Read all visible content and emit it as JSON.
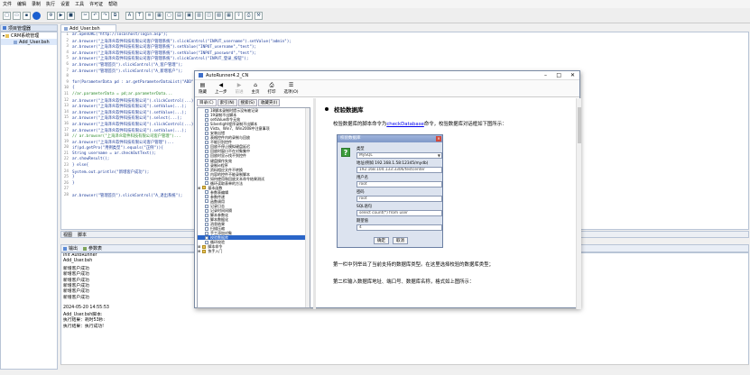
{
  "menu": [
    "文件",
    "编辑",
    "录制",
    "执行",
    "设置",
    "工具",
    "许可证",
    "帮助"
  ],
  "left_panel": {
    "tab": "项目管理器",
    "tree": [
      {
        "label": "CRM系统管理",
        "level": 0
      },
      {
        "label": "Add_User.bsh",
        "level": 1,
        "selected": true
      }
    ]
  },
  "editor": {
    "tab": "Add_User.bsh",
    "lines": [
      {
        "n": "1",
        "t": "ar.openURL(\"http://localhost/login.asp\");"
      },
      {
        "n": "2",
        "t": "ar.browser(\"上海泽众软件科技有限公司客户管理系统\").slickControl(\"INPUT_username\").setValue(\"admin\");"
      },
      {
        "n": "3",
        "t": "ar.browser(\"上海泽众软件科技有限公司客户管理系统\").setValue(\"INPUT_username\",\"test\");"
      },
      {
        "n": "4",
        "t": "ar.browser(\"上海泽众软件科技有限公司客户管理系统\").setValue(\"INPUT_password\",\"test\");"
      },
      {
        "n": "5",
        "t": "ar.browser(\"上海泽众软件科技有限公司客户管理系统\").slickControl(\"INPUT_登录_按钮\");"
      },
      {
        "n": "6",
        "t": "ar.browser(\"管理首页\").slickControl(\"A_客户管理\");"
      },
      {
        "n": "7",
        "t": "ar.browser(\"管理首页\").slickControl(\"A_新增客户\");"
      },
      {
        "n": "8",
        "t": ""
      },
      {
        "n": "9",
        "t": "for(ParameterData pd : ar.getParameterDataList(\"ADD\")){"
      },
      {
        "n": "10",
        "t": "{"
      },
      {
        "n": "11",
        "t": "    //ar.parameterData = pd;ar.parameterData...",
        "c": true
      },
      {
        "n": "12",
        "t": "    ar.browser(\"上海泽众软件科技有限公司\").slickControl(...);"
      },
      {
        "n": "13",
        "t": "    ar.browser(\"上海泽众软件科技有限公司\").setValue(...);"
      },
      {
        "n": "14",
        "t": "    ar.browser(\"上海泽众软件科技有限公司\").setValue(...);"
      },
      {
        "n": "15",
        "t": "    ar.browser(\"上海泽众软件科技有限公司\").select(...);"
      },
      {
        "n": "16",
        "t": "    ar.browser(\"上海泽众软件科技有限公司\").slickControl(...);"
      },
      {
        "n": "17",
        "t": "    ar.browser(\"上海泽众软件科技有限公司\").setValue(...);"
      },
      {
        "n": "18",
        "t": "    // ar.browser(\"上海泽众软件科技有限公司客户管理\")...",
        "c": true
      },
      {
        "n": "19",
        "t": "    ar.browser(\"上海泽众软件科技有限公司客户管理\")..."
      },
      {
        "n": "20",
        "t": "    if(pd.getPro(\"用例类型\").equals(\"正例\")){"
      },
      {
        "n": "21",
        "t": "        String username = ar.checkOutText();"
      },
      {
        "n": "22",
        "t": "        ar.showResult();"
      },
      {
        "n": "23",
        "t": "    } else{"
      },
      {
        "n": "24",
        "t": "        System.out.println(\"新增客户成功\");"
      },
      {
        "n": "25",
        "t": "    }"
      },
      {
        "n": "26",
        "t": "}"
      },
      {
        "n": "27",
        "t": ""
      },
      {
        "n": "28",
        "t": "ar.browser(\"管理首页\").slickControl(\"A_退出系统\");"
      }
    ]
  },
  "bottom_tabs": [
    "视图",
    "脚本"
  ],
  "output": {
    "tabs": [
      "输出",
      "参数表"
    ],
    "lines": [
      "Init AutoRunner",
      "Add_User.bsh",
      "新增客户成功",
      "新增客户成功",
      "新增客户成功",
      "新增客户成功",
      "新增客户成功",
      "新增客户成功",
      "",
      "2024-05-20 14:55:53",
      "Add_User.bsh脚本:",
      "执行结果：耗时53秒:",
      "执行结果：执行成功!"
    ]
  },
  "help": {
    "title": "AutoRunner4.2_CN",
    "toolbar": [
      {
        "label": "隐藏",
        "icon": "hide-icon",
        "glyph": "▤"
      },
      {
        "label": "上一步",
        "icon": "back-icon",
        "glyph": "◀"
      },
      {
        "label": "前进",
        "icon": "forward-icon",
        "glyph": "▶"
      },
      {
        "label": "主页",
        "icon": "home-icon",
        "glyph": "⌂"
      },
      {
        "label": "打印",
        "icon": "print-icon",
        "glyph": "⎙"
      },
      {
        "label": "选项(O)",
        "icon": "options-icon",
        "glyph": "☰"
      }
    ],
    "nav_tabs": [
      "目录(C)",
      "索引(N)",
      "搜索(S)",
      "收藏夹(I)"
    ],
    "nav_items": [
      {
        "t": "18脚本录制时提示没有被记录"
      },
      {
        "t": "19录制不出脚本"
      },
      {
        "t": "setValue命令无效"
      },
      {
        "t": "Silverlight程序录制不出脚本"
      },
      {
        "t": "Vista、Win7、Win2008中注意事项"
      },
      {
        "t": "安装出错"
      },
      {
        "t": "表格控件内的录制与回放"
      },
      {
        "t": "不能识别控件"
      },
      {
        "t": "回放不停止模拟键盘延迟"
      },
      {
        "t": "回放时窗口不在对象集中"
      },
      {
        "t": "回放时显示找不到控件"
      },
      {
        "t": "键盘操作失效"
      },
      {
        "t": "录制ie程序"
      },
      {
        "t": "资料相应文件不转换"
      },
      {
        "t": "内容的控件不能录制脚本"
      },
      {
        "t": "如何使用和回放文本命令结果测试"
      },
      {
        "t": "循环读取表单的方法"
      },
      {
        "t": "基本函数",
        "folder": true
      },
      {
        "t": "参数表编辑"
      },
      {
        "t": "参数传递"
      },
      {
        "t": "函数调用"
      },
      {
        "t": "记录日志"
      },
      {
        "t": "记录时间间隔"
      },
      {
        "t": "脚本参数化"
      },
      {
        "t": "脚本数据化"
      },
      {
        "t": "消息结果"
      },
      {
        "t": "扫描压缩"
      },
      {
        "t": "手工添加对象"
      },
      {
        "t": "校验数据库",
        "sel": true
      },
      {
        "t": "循环校验"
      },
      {
        "t": "脚本命令",
        "folder": true
      },
      {
        "t": "快手入门",
        "folder": true
      }
    ],
    "content": {
      "heading": "校验数据库",
      "para1_a": "校验数据库的脚本命令为",
      "para1_link": "checkDatabase",
      "para1_b": "命令，校验数据库对话框如下图所示：",
      "para2": "第一栏中列举出了当前支持的数据库类型。在这里选择校验的数据库类型；",
      "para3": "第二栏输入数据库地址、端口号、数据库名称，格式如上图所示："
    },
    "dialog": {
      "title": "校验数据库",
      "type_label": "类型",
      "type_value": "MySQL",
      "addr_label": "地址(例如 192.168.1.58:12345/mydb)",
      "addr_value": "192.168.104.133:3306/testcenter",
      "user_label": "用户名",
      "user_value": "root",
      "pass_label": "密码",
      "pass_value": "root",
      "sql_label": "SQL语句",
      "sql_value": "select count(*) from user",
      "expect_label": "期望值",
      "expect_value": "4",
      "ok": "确定",
      "cancel": "取消"
    }
  }
}
